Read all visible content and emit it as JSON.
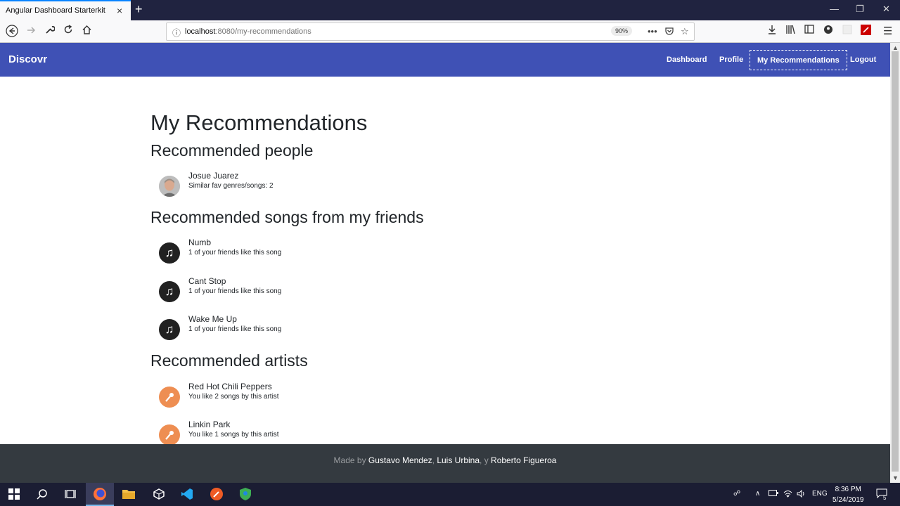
{
  "browser": {
    "tab_title": "Angular Dashboard Starterkit",
    "tab_close_icon": "×",
    "new_tab_icon": "+",
    "url_host": "localhost",
    "url_path": ":8080/my-recommendations",
    "zoom": "90%",
    "window_controls": [
      "—",
      "❐",
      "✕"
    ]
  },
  "navbar": {
    "brand": "Discovr",
    "links": [
      "Dashboard",
      "Profile",
      "My Recommendations",
      "Logout"
    ],
    "active_link": "My Recommendations"
  },
  "page": {
    "title": "My Recommendations",
    "sections": {
      "people": {
        "title": "Recommended people",
        "items": [
          {
            "name": "Josue Juarez",
            "sub": "Similar fav genres/songs: 2"
          }
        ]
      },
      "songs": {
        "title": "Recommended songs from my friends",
        "items": [
          {
            "name": "Numb",
            "sub": "1 of your friends like this song"
          },
          {
            "name": "Cant Stop",
            "sub": "1 of your friends like this song"
          },
          {
            "name": "Wake Me Up",
            "sub": "1 of your friends like this song"
          }
        ]
      },
      "artists": {
        "title": "Recommended artists",
        "items": [
          {
            "name": "Red Hot Chili Peppers",
            "sub": "You like 2 songs by this artist"
          },
          {
            "name": "Linkin Park",
            "sub": "You like 1 songs by this artist"
          }
        ]
      }
    }
  },
  "footer": {
    "made_by": "Made by",
    "authors": [
      "Gustavo Mendez",
      "Luis Urbina",
      "Roberto Figueroa"
    ],
    "sep1": ",",
    "sep2": ", y"
  },
  "taskbar": {
    "language": "ENG",
    "time": "8:36 PM",
    "date": "5/24/2019",
    "notifications": "5"
  },
  "colors": {
    "navbar": "#3f51b5",
    "footer": "#343a40",
    "artist_avatar": "#ee8e52",
    "song_avatar": "#212121"
  }
}
